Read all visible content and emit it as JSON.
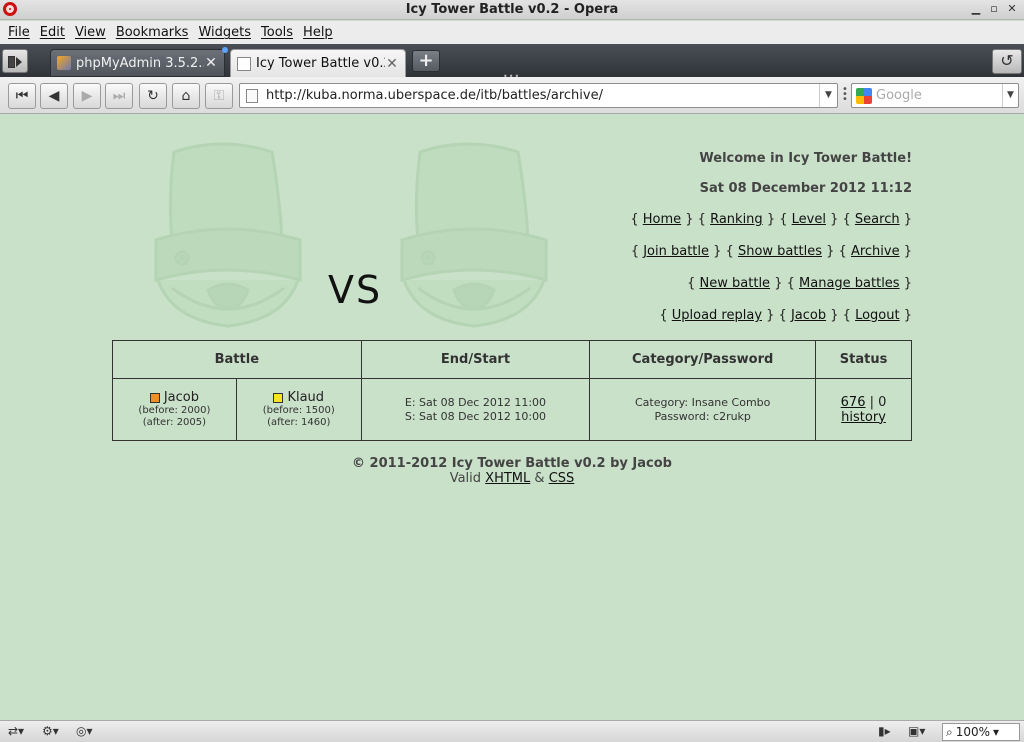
{
  "window": {
    "title": "Icy Tower Battle v0.2 - Opera"
  },
  "menu": [
    "File",
    "Edit",
    "View",
    "Bookmarks",
    "Widgets",
    "Tools",
    "Help"
  ],
  "tabs": [
    {
      "label": "phpMyAdmin 3.5.2...",
      "active": false
    },
    {
      "label": "Icy Tower Battle v0.2",
      "active": true
    }
  ],
  "address": {
    "url": "http://kuba.norma.uberspace.de/itb/battles/archive/"
  },
  "search": {
    "placeholder": "Google"
  },
  "page": {
    "vs": "VS",
    "welcome": "Welcome in Icy Tower Battle!",
    "date": "Sat 08 December 2012 11:12",
    "nav": {
      "home": "Home",
      "ranking": "Ranking",
      "level": "Level",
      "search": "Search",
      "join_battle": "Join battle",
      "show_battles": "Show battles",
      "archive": "Archive",
      "new_battle": "New battle",
      "manage_battles": "Manage battles",
      "upload_replay": "Upload replay",
      "user": "Jacob",
      "logout": "Logout"
    },
    "table": {
      "headers": [
        "Battle",
        "End/Start",
        "Category/Password",
        "Status"
      ],
      "rows": [
        {
          "player1": {
            "name": "Jacob",
            "color": "#f0901e",
            "before": "(before: 2000)",
            "after": "(after: 2005)"
          },
          "player2": {
            "name": "Klaud",
            "color": "#f5e61b",
            "before": "(before: 1500)",
            "after": "(after: 1460)"
          },
          "end": "E: Sat 08 Dec 2012 11:00",
          "start": "S: Sat 08 Dec 2012 10:00",
          "category": "Category: Insane Combo",
          "password": "Password: c2rukp",
          "status_score": "676",
          "status_sep": " | 0",
          "history": "history"
        }
      ]
    },
    "footer": {
      "copyright": "© 2011-2012 Icy Tower Battle v0.2 by Jacob",
      "valid": "Valid",
      "xhtml": "XHTML",
      "amp": "&",
      "css": "CSS"
    }
  },
  "statusbar": {
    "zoom": "100%"
  },
  "colors": {
    "page_bg": "#c9e0c9",
    "mascot": "#b7d6b7"
  }
}
